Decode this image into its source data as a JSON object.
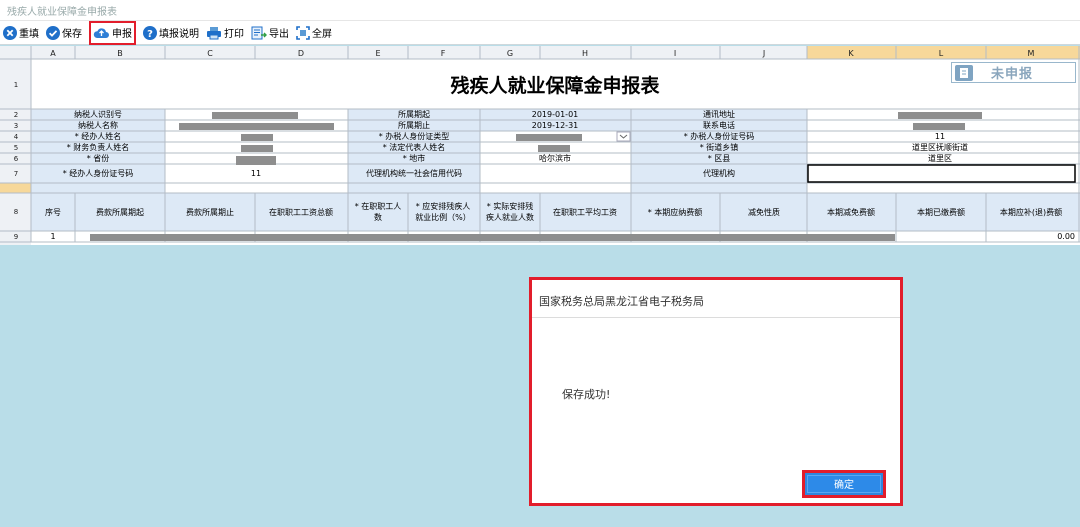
{
  "window": {
    "title": "残疾人就业保障金申报表"
  },
  "toolbar": {
    "reset": "重填",
    "save": "保存",
    "declare": "申报",
    "help": "填报说明",
    "print": "打印",
    "export": "导出",
    "fullscreen": "全屏"
  },
  "sheet": {
    "columns": [
      "A",
      "B",
      "C",
      "D",
      "E",
      "F",
      "G",
      "H",
      "I",
      "J",
      "K",
      "L",
      "M"
    ],
    "rows": [
      "1",
      "2",
      "3",
      "4",
      "5",
      "6",
      "7",
      "8",
      "9"
    ],
    "title": "残疾人就业保障金申报表",
    "stamp": "未申报",
    "r2": {
      "label1": "纳税人识别号",
      "label2": "所属期起",
      "value2": "2019-01-01",
      "label3": "通讯地址"
    },
    "r3": {
      "label1": "纳税人名称",
      "label2": "所属期止",
      "value2": "2019-12-31",
      "label3": "联系电话"
    },
    "r4": {
      "label1": "* 经办人姓名",
      "label2": "* 办税人身份证类型",
      "label3": "* 办税人身份证号码",
      "value3": "11"
    },
    "r5": {
      "label1": "* 财务负责人姓名",
      "label2": "* 法定代表人姓名",
      "label3": "* 街道乡镇",
      "value3": "道里区抚顺街道"
    },
    "r6": {
      "label1": "* 省份",
      "label2": "* 地市",
      "value2": "哈尔滨市",
      "label3": "* 区县",
      "value3": "道里区"
    },
    "r7": {
      "label1": "* 经办人身份证号码",
      "value1": "11",
      "label2": "代理机构统一社会信用代码",
      "label3": "代理机构"
    },
    "r8": {
      "h1": "序号",
      "h2": "费款所属期起",
      "h3": "费款所属期止",
      "h4": "在职职工工资总额",
      "h5a": "* 在职职工人",
      "h5b": "数",
      "h6a": "* 应安排残疾人",
      "h6b": "就业比例（%）",
      "h7a": "* 实际安排残",
      "h7b": "疾人就业人数",
      "h8": "在职职工平均工资",
      "h9": "* 本期应纳费额",
      "h10": "减免性质",
      "h11": "本期减免费额",
      "h12": "本期已缴费额",
      "h13": "本期应补(退)费额"
    },
    "r9": {
      "index": "1",
      "total": "0.00"
    }
  },
  "dialog": {
    "title": "国家税务总局黑龙江省电子税务局",
    "message": "保存成功!",
    "ok": "确定"
  }
}
